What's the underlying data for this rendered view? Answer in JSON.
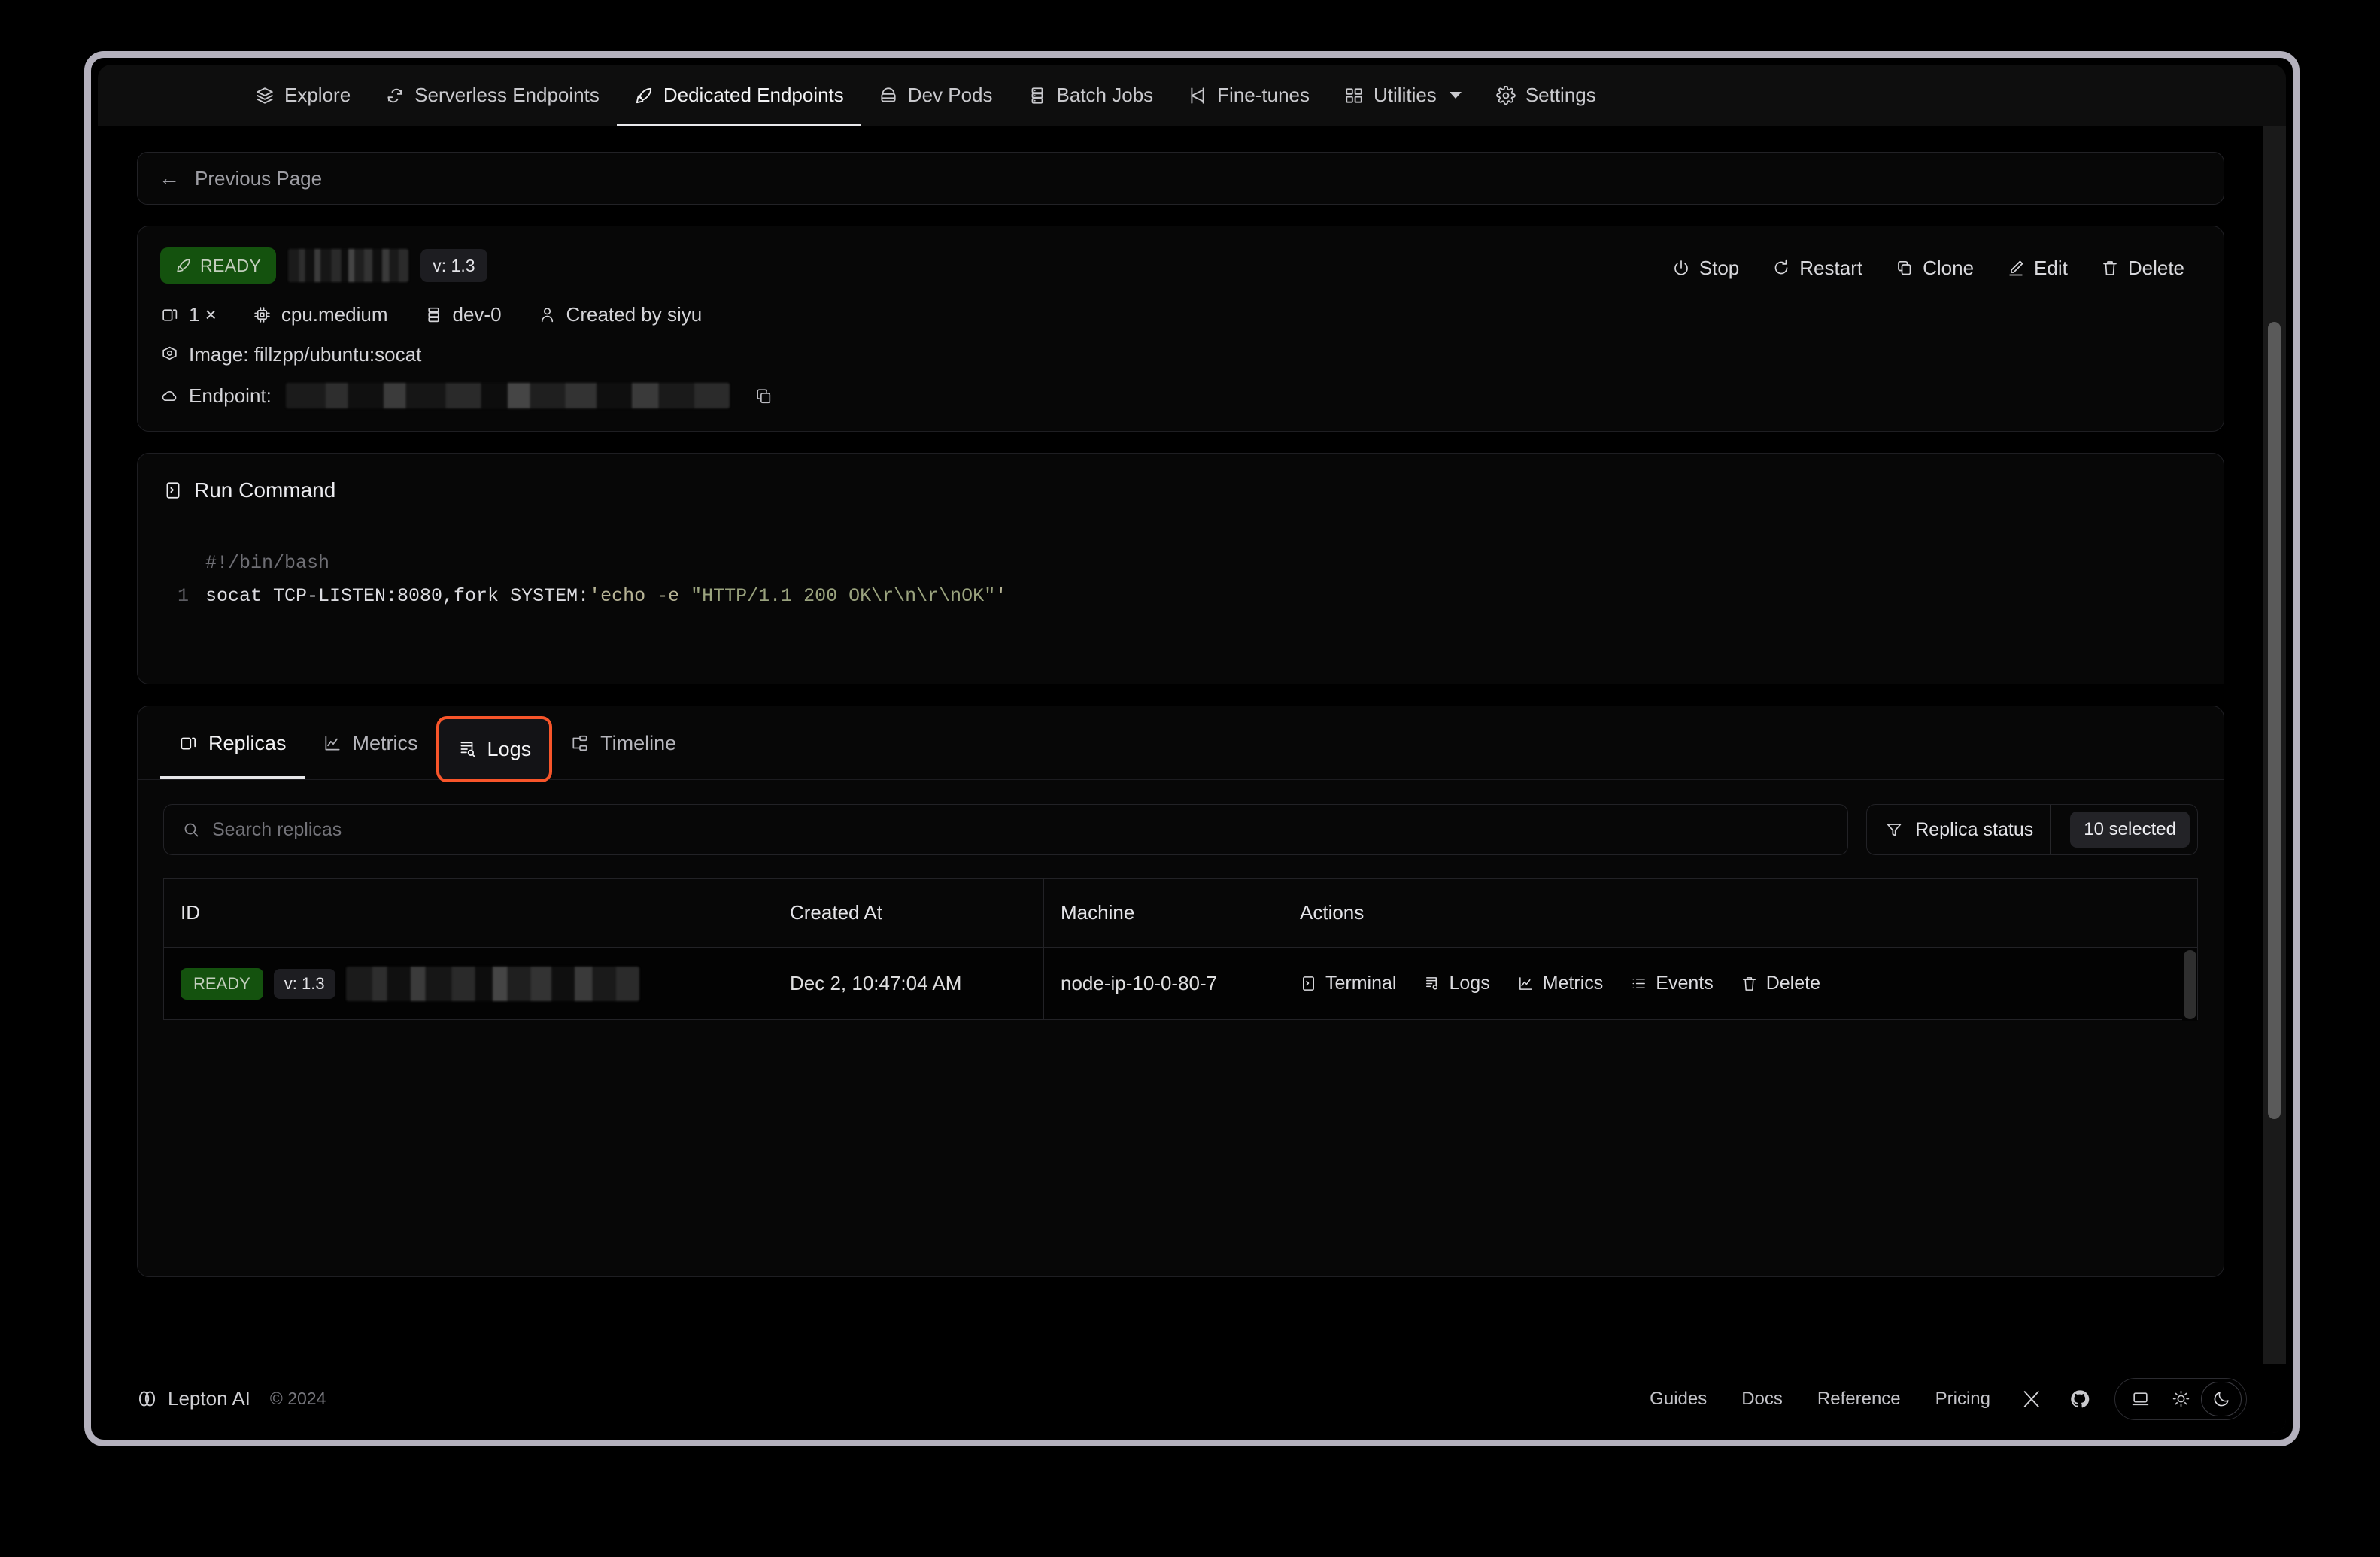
{
  "topnav": {
    "items": [
      {
        "label": "Explore",
        "icon": "layers-icon",
        "active": false
      },
      {
        "label": "Serverless Endpoints",
        "icon": "refresh-cloud-icon",
        "active": false
      },
      {
        "label": "Dedicated Endpoints",
        "icon": "rocket-icon",
        "active": true
      },
      {
        "label": "Dev Pods",
        "icon": "pod-icon",
        "active": false
      },
      {
        "label": "Batch Jobs",
        "icon": "server-stack-icon",
        "active": false
      },
      {
        "label": "Fine-tunes",
        "icon": "tune-icon",
        "active": false
      },
      {
        "label": "Utilities",
        "icon": "grid-icon",
        "active": false,
        "caret": true
      },
      {
        "label": "Settings",
        "icon": "gear-icon",
        "active": false
      }
    ]
  },
  "previous_page": {
    "label": "Previous Page",
    "icon": "arrow-left-icon"
  },
  "status_card": {
    "badge": "READY",
    "name_redacted": true,
    "version": "v: 1.3",
    "replicas": "1 ×",
    "shape": "cpu.medium",
    "workspace": "dev-0",
    "created_by": "Created by siyu",
    "image_label": "Image: fillzpp/ubuntu:socat",
    "endpoint_label": "Endpoint:",
    "endpoint_redacted": true,
    "actions": [
      {
        "label": "Stop",
        "icon": "power-icon"
      },
      {
        "label": "Restart",
        "icon": "restart-icon"
      },
      {
        "label": "Clone",
        "icon": "copy-icon"
      },
      {
        "label": "Edit",
        "icon": "pencil-icon"
      },
      {
        "label": "Delete",
        "icon": "trash-icon"
      }
    ]
  },
  "run_command": {
    "title": "Run Command",
    "icon": "terminal-icon",
    "shebang": "#!/bin/bash",
    "line_number": "1",
    "code_plain_1": "socat TCP-LISTEN:8080,fork SYSTEM:",
    "code_str_open": "'echo -e ",
    "code_str_inner": "\"HTTP/1.1 200 OK\\r\\n\\r\\nOK\"",
    "code_str_close": "'"
  },
  "tabs": {
    "items": [
      {
        "label": "Replicas",
        "icon": "replicas-icon",
        "state": "active"
      },
      {
        "label": "Metrics",
        "icon": "chart-line-icon",
        "state": "normal"
      },
      {
        "label": "Logs",
        "icon": "logs-search-icon",
        "state": "highlight"
      },
      {
        "label": "Timeline",
        "icon": "timeline-icon",
        "state": "normal"
      }
    ],
    "highlight_color": "#f8552a"
  },
  "filters": {
    "search_placeholder": "Search replicas",
    "search_value": "",
    "search_icon": "search-icon",
    "status_filter_label": "Replica status",
    "status_filter_icon": "filter-icon",
    "status_filter_count": "10 selected"
  },
  "table": {
    "columns": [
      "ID",
      "Created At",
      "Machine",
      "Actions"
    ],
    "rows": [
      {
        "badge": "READY",
        "version": "v: 1.3",
        "id_redacted": true,
        "created_at": "Dec 2, 10:47:04 AM",
        "machine": "node-ip-10-0-80-7",
        "actions": [
          {
            "label": "Terminal",
            "icon": "terminal-icon"
          },
          {
            "label": "Logs",
            "icon": "logs-icon"
          },
          {
            "label": "Metrics",
            "icon": "chart-line-icon"
          },
          {
            "label": "Events",
            "icon": "list-icon"
          },
          {
            "label": "Delete",
            "icon": "trash-icon"
          }
        ]
      }
    ]
  },
  "footer": {
    "brand": "Lepton AI",
    "brand_icon": "lepton-logo-icon",
    "copyright": "© 2024",
    "links": [
      "Guides",
      "Docs",
      "Reference",
      "Pricing"
    ],
    "social": [
      {
        "name": "x-twitter-icon"
      },
      {
        "name": "github-icon"
      }
    ],
    "theme_options": [
      {
        "name": "system-theme-icon",
        "selected": false
      },
      {
        "name": "light-theme-icon",
        "selected": false
      },
      {
        "name": "dark-theme-icon",
        "selected": true
      }
    ]
  },
  "colors": {
    "accent_highlight": "#f8552a",
    "ready_green": "#14520e",
    "background": "#000000",
    "frame_border": "#b4b1bd"
  }
}
